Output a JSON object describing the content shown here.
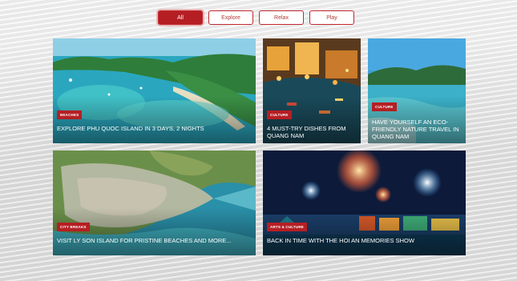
{
  "filters": {
    "all": "All",
    "explore": "Explore",
    "relax": "Relax",
    "play": "Play"
  },
  "cards": [
    {
      "tag": "BEACHES",
      "title": "EXPLORE PHU QUOC ISLAND IN 3 DAYS, 2 NIGHTS"
    },
    {
      "tag": "CULTURE",
      "title": "4 MUST-TRY DISHES FROM QUANG NAM"
    },
    {
      "tag": "CULTURE",
      "title": "HAVE YOURSELF AN ECO-FRIENDLY NATURE TRAVEL IN QUANG NAM"
    },
    {
      "tag": "CITY BREAKS",
      "title": "VISIT LY SON ISLAND FOR PRISTINE BEACHES AND MORE..."
    },
    {
      "tag": "ARTS & CULTURE",
      "title": "BACK IN TIME WITH THE HOI AN MEMORIES SHOW"
    }
  ],
  "colors": {
    "accent": "#b51f24"
  }
}
